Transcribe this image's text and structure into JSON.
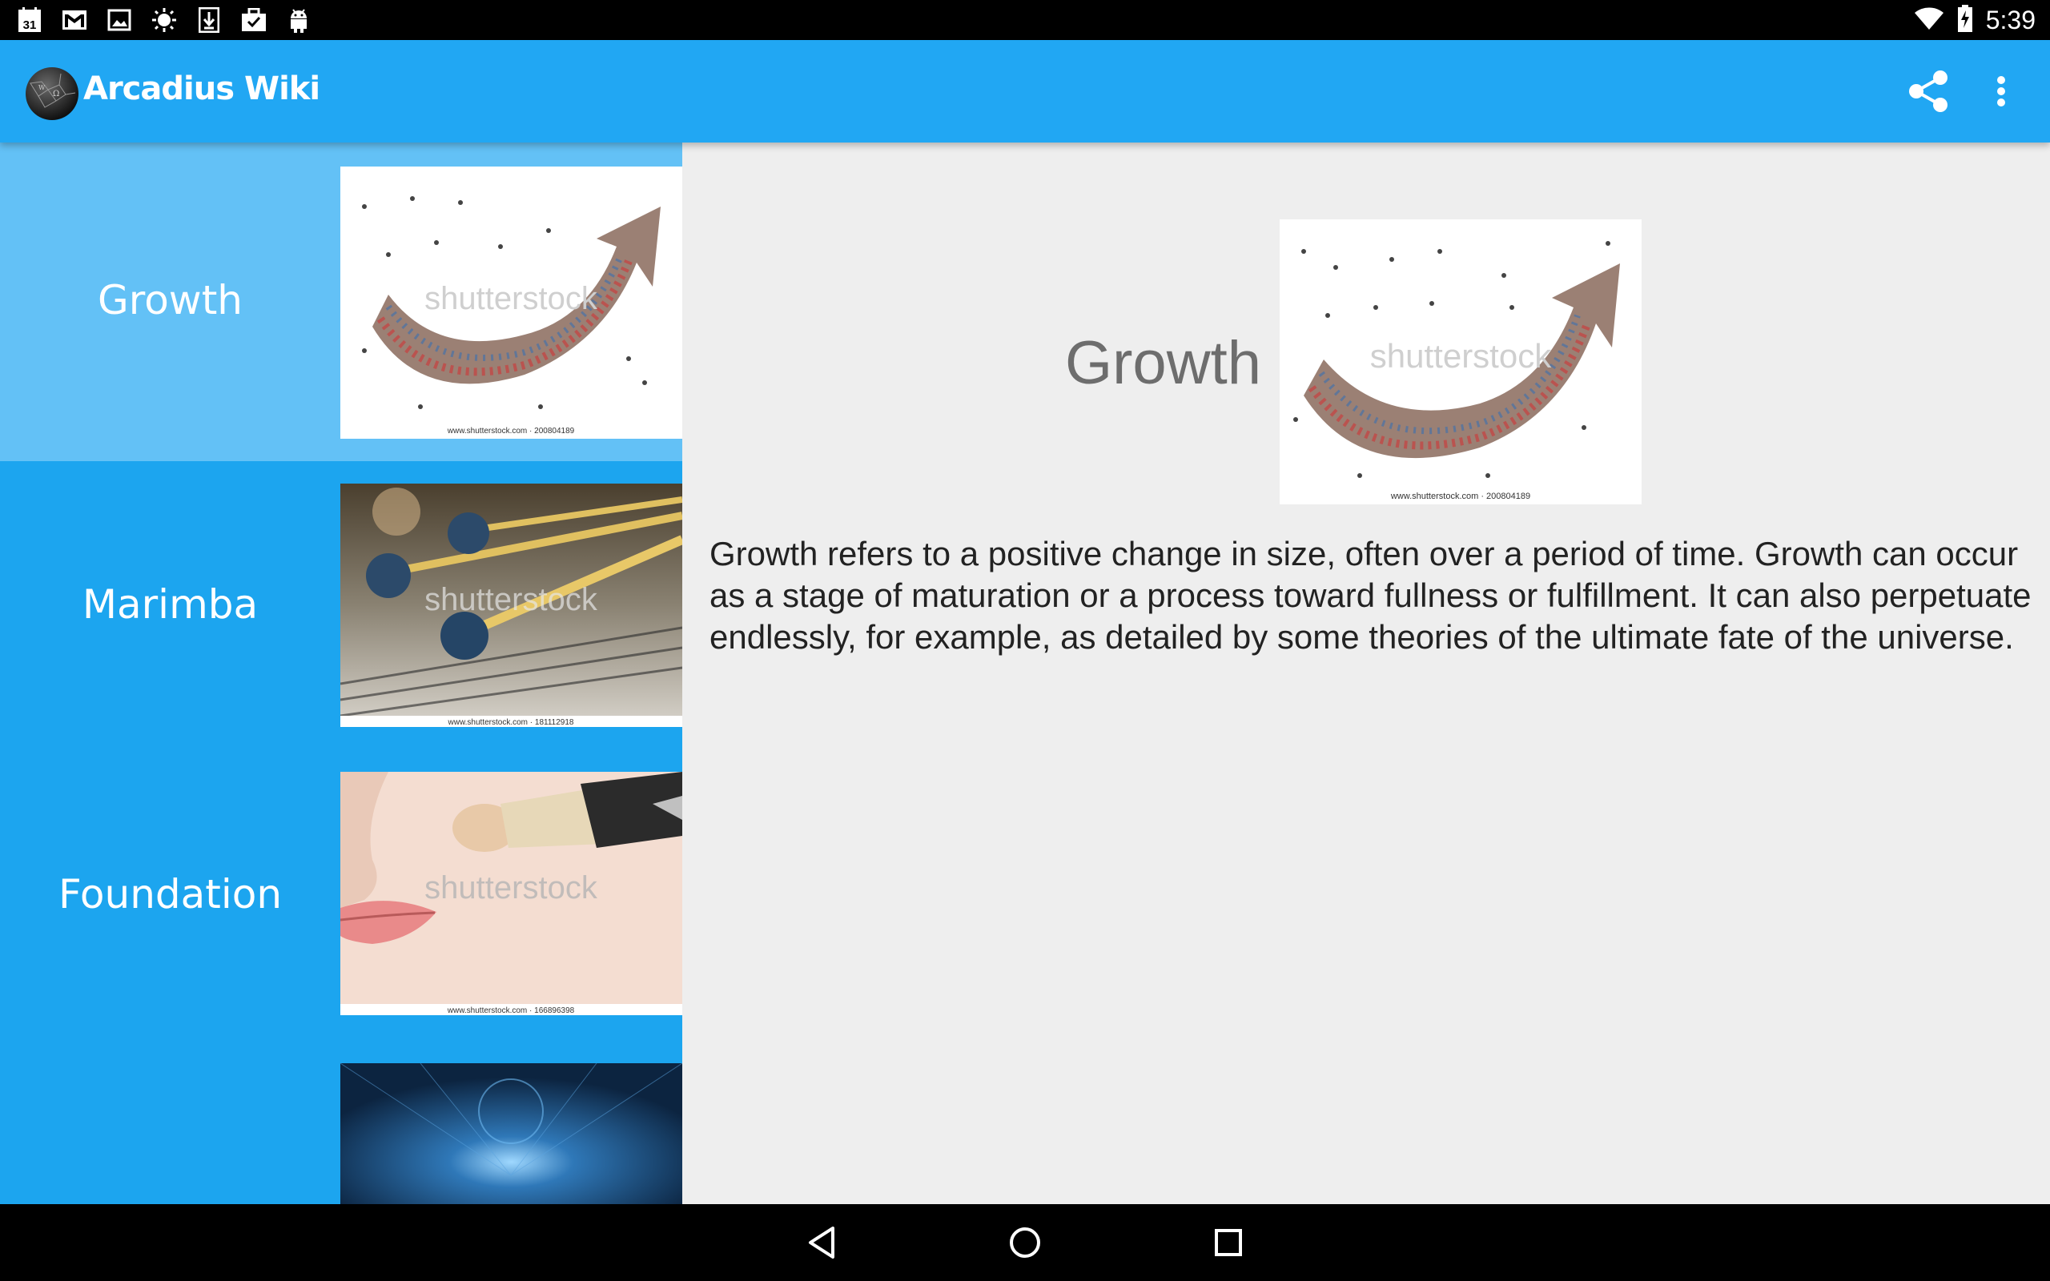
{
  "status_bar": {
    "time": "5:39",
    "calendar_day": "31",
    "left_icons": [
      "calendar-icon",
      "gmail-icon",
      "photos-icon",
      "brightness-icon",
      "download-icon",
      "briefcase-icon",
      "android-icon"
    ],
    "right_icons": [
      "wifi-icon",
      "battery-charging-icon"
    ]
  },
  "app_bar": {
    "title": "Arcadius Wiki",
    "actions": [
      "share-icon",
      "more-vert-icon"
    ],
    "color": "#21a7f3"
  },
  "sidebar": {
    "color": "#1ca5ef",
    "selected_color": "#63c1f6",
    "items": [
      {
        "label": "Growth",
        "selected": true,
        "watermark": "shutterstock",
        "caption": "www.shutterstock.com · 200804189"
      },
      {
        "label": "Marimba",
        "selected": false,
        "watermark": "shutterstock",
        "caption": "www.shutterstock.com · 181112918"
      },
      {
        "label": "Foundation",
        "selected": false,
        "watermark": "shutterstock",
        "caption": "www.shutterstock.com · 166896398"
      },
      {
        "label": "",
        "selected": false
      }
    ]
  },
  "detail": {
    "title": "Growth",
    "image_watermark": "shutterstock",
    "image_caption": "www.shutterstock.com · 200804189",
    "body": "Growth refers to a positive change in size, often over a period of time. Growth can occur as a stage of maturation or a process toward fullness or fulfillment. It can also perpetuate endlessly, for example, as detailed by some theories of the ultimate fate of the universe."
  },
  "nav_bar": {
    "buttons": [
      "back-icon",
      "home-icon",
      "recents-icon"
    ]
  }
}
